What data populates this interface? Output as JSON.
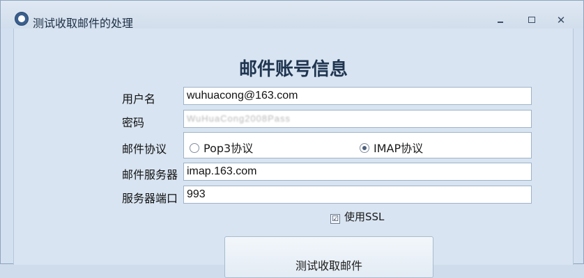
{
  "window": {
    "title": "测试收取邮件的处理",
    "icon": "app-logo-icon"
  },
  "form": {
    "heading": "邮件账号信息",
    "username": {
      "label": "用户名",
      "value": "wuhuacong@163.com"
    },
    "password": {
      "label": "密码",
      "masked_value": "WuHuaCong2008Pass"
    },
    "protocol": {
      "label": "邮件协议",
      "options": [
        {
          "label": "Pop3协议",
          "selected": false
        },
        {
          "label": "IMAP协议",
          "selected": true
        }
      ]
    },
    "server": {
      "label": "邮件服务器",
      "value": "imap.163.com"
    },
    "port": {
      "label": "服务器端口",
      "value": "993"
    },
    "ssl": {
      "label": "使用SSL",
      "checked": true,
      "check_mark": "☑"
    },
    "test_button": {
      "label": "测试收取邮件"
    }
  }
}
